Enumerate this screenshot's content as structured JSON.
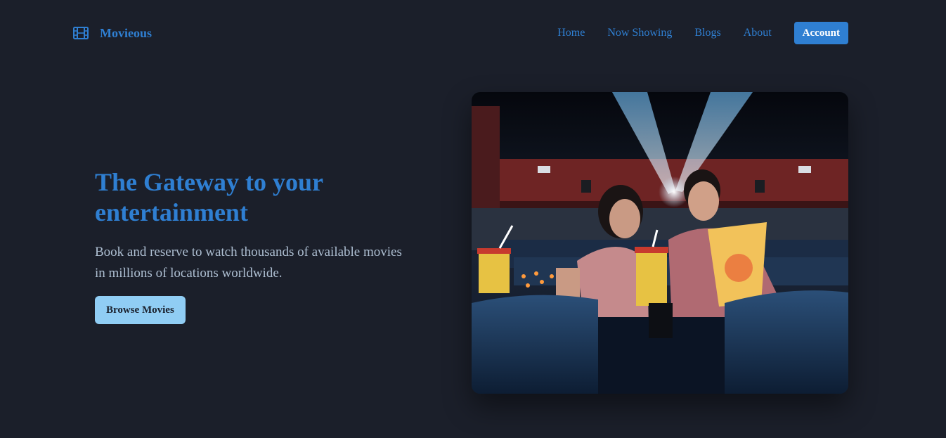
{
  "brand": {
    "name": "Movieous",
    "icon": "film-icon"
  },
  "nav": {
    "links": [
      "Home",
      "Now Showing",
      "Blogs",
      "About"
    ],
    "account_label": "Account"
  },
  "hero": {
    "title": "The Gateway to your entertainment",
    "subtitle": "Book and reserve to watch thousands of available movies in millions of locations worldwide.",
    "cta_label": "Browse Movies",
    "image": "couple-in-movie-theater-photo"
  },
  "colors": {
    "background": "#1b1f2a",
    "accent": "#2f7fd2",
    "cta_background": "#90cdf4",
    "subtitle_text": "#aebfd2"
  }
}
